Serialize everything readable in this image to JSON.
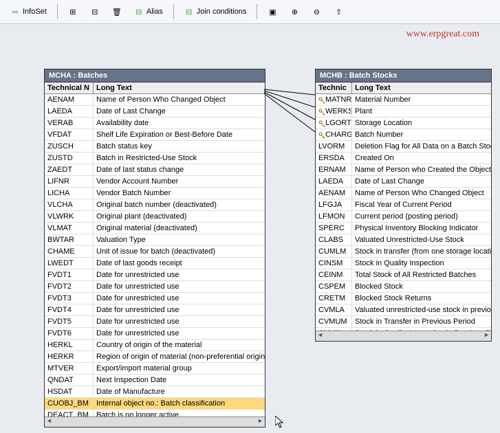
{
  "toolbar": {
    "infoset_label": "InfoSet",
    "alias_label": "Alias",
    "join_label": "Join conditions"
  },
  "watermark": "www.erpgreat.com",
  "left": {
    "title": "MCHA : Batches",
    "header_tech": "Technical N",
    "header_long": "Long Text",
    "rows": [
      {
        "tech": "AENAM",
        "long": "Name of Person Who Changed Object"
      },
      {
        "tech": "LAEDA",
        "long": "Date of Last Change"
      },
      {
        "tech": "VERAB",
        "long": "Availability date"
      },
      {
        "tech": "VFDAT",
        "long": "Shelf Life Expiration or Best-Before Date"
      },
      {
        "tech": "ZUSCH",
        "long": "Batch status key"
      },
      {
        "tech": "ZUSTD",
        "long": "Batch in Restricted-Use Stock"
      },
      {
        "tech": "ZAEDT",
        "long": "Date of last status change"
      },
      {
        "tech": "LIFNR",
        "long": "Vendor Account Number"
      },
      {
        "tech": "LICHA",
        "long": "Vendor Batch Number"
      },
      {
        "tech": "VLCHA",
        "long": "Original batch number (deactivated)"
      },
      {
        "tech": "VLWRK",
        "long": "Original plant  (deactivated)"
      },
      {
        "tech": "VLMAT",
        "long": "Original material   (deactivated)"
      },
      {
        "tech": "BWTAR",
        "long": "Valuation Type"
      },
      {
        "tech": "CHAME",
        "long": "Unit of issue for batch (deactivated)"
      },
      {
        "tech": "LWEDT",
        "long": "Date of last goods receipt"
      },
      {
        "tech": "FVDT1",
        "long": "Date for unrestricted use"
      },
      {
        "tech": "FVDT2",
        "long": "Date for unrestricted use"
      },
      {
        "tech": "FVDT3",
        "long": "Date for unrestricted use"
      },
      {
        "tech": "FVDT4",
        "long": "Date for unrestricted use"
      },
      {
        "tech": "FVDT5",
        "long": "Date for unrestricted use"
      },
      {
        "tech": "FVDT6",
        "long": "Date for unrestricted use"
      },
      {
        "tech": "HERKL",
        "long": "Country of origin of the material"
      },
      {
        "tech": "HERKR",
        "long": "Region of origin of material (non-preferential origin)"
      },
      {
        "tech": "MTVER",
        "long": "Export/import material group"
      },
      {
        "tech": "QNDAT",
        "long": "Next Inspection Date"
      },
      {
        "tech": "HSDAT",
        "long": "Date of Manufacture"
      },
      {
        "tech": "CUOBJ_BM",
        "long": "Internal object no.: Batch classification",
        "selected": true
      },
      {
        "tech": "DEACT_BM",
        "long": "Batch is no longer active"
      }
    ]
  },
  "right": {
    "title": "MCHB : Batch Stocks",
    "header_tech": "Technic",
    "header_long": "Long Text",
    "rows": [
      {
        "tech": "MATNR",
        "long": "Material Number",
        "key": true
      },
      {
        "tech": "WERKS",
        "long": "Plant",
        "key": true
      },
      {
        "tech": "LGORT",
        "long": "Storage Location",
        "key": true
      },
      {
        "tech": "CHARG",
        "long": "Batch Number",
        "key": true
      },
      {
        "tech": "LVORM",
        "long": "Deletion Flag for All Data on a Batch Stock"
      },
      {
        "tech": "ERSDA",
        "long": "Created On"
      },
      {
        "tech": "ERNAM",
        "long": "Name of Person who Created the Object"
      },
      {
        "tech": "LAEDA",
        "long": "Date of Last Change"
      },
      {
        "tech": "AENAM",
        "long": "Name of Person Who Changed Object"
      },
      {
        "tech": "LFGJA",
        "long": "Fiscal Year of Current Period"
      },
      {
        "tech": "LFMON",
        "long": "Current period (posting period)"
      },
      {
        "tech": "SPERC",
        "long": "Physical Inventory Blocking Indicator"
      },
      {
        "tech": "CLABS",
        "long": "Valuated Unrestricted-Use Stock"
      },
      {
        "tech": "CUMLM",
        "long": "Stock in transfer (from one storage location"
      },
      {
        "tech": "CINSM",
        "long": "Stock in Quality Inspection"
      },
      {
        "tech": "CEINM",
        "long": "Total Stock of All Restricted Batches"
      },
      {
        "tech": "CSPEM",
        "long": "Blocked Stock"
      },
      {
        "tech": "CRETM",
        "long": "Blocked Stock Returns"
      },
      {
        "tech": "CVMLA",
        "long": "Valuated unrestricted-use stock in previous"
      },
      {
        "tech": "CVMUM",
        "long": "Stock in Transfer in Previous Period"
      },
      {
        "tech": "CVMIN",
        "long": "Stock in Quality Inspection in Previous Per"
      }
    ]
  }
}
